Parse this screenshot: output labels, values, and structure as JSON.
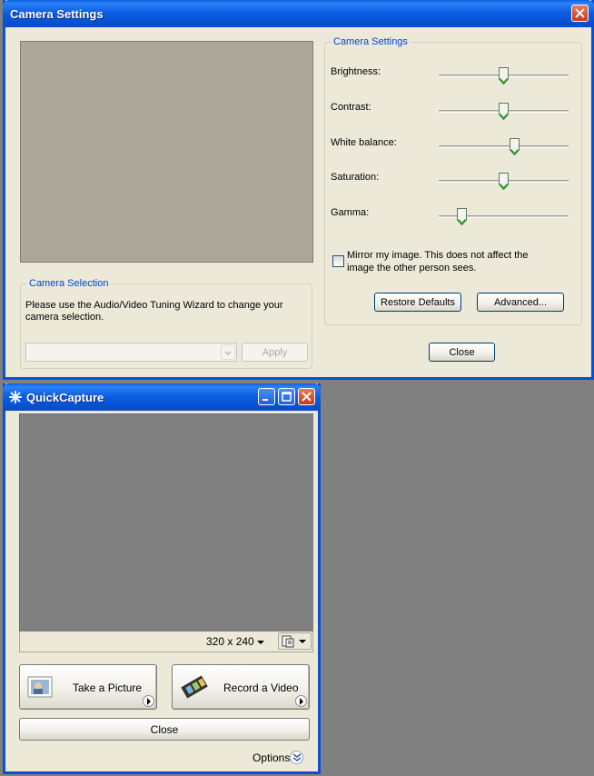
{
  "camera_settings": {
    "title": "Camera Settings",
    "settings_group": {
      "title": "Camera Settings",
      "sliders": [
        {
          "label": "Brightness:",
          "value": 0.5
        },
        {
          "label": "Contrast:",
          "value": 0.5
        },
        {
          "label": "White balance:",
          "value": 0.59
        },
        {
          "label": "Saturation:",
          "value": 0.5
        },
        {
          "label": "Gamma:",
          "value": 0.15
        }
      ],
      "mirror_label_line1": "Mirror my image.  This does not affect the",
      "mirror_label_line2": "image the other person sees.",
      "mirror_checked": false,
      "restore_defaults": "Restore Defaults",
      "advanced": "Advanced..."
    },
    "selection_group": {
      "title": "Camera Selection",
      "text_line1": "Please use the Audio/Video Tuning Wizard to change your",
      "text_line2": "camera selection.",
      "apply": "Apply"
    },
    "close": "Close"
  },
  "quickcapture": {
    "title": "QuickCapture",
    "resolution": "320 x 240",
    "take_picture": "Take a Picture",
    "record_video": "Record a Video",
    "close": "Close",
    "options": "Options"
  },
  "colors": {
    "titlebar": "#0a5fe0",
    "window_bg": "#ece9d8",
    "group_title": "#0046d5",
    "desktop": "#808080"
  }
}
